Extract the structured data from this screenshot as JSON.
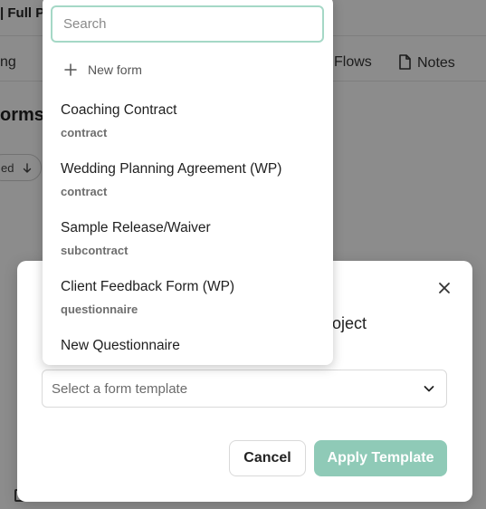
{
  "background": {
    "header_title": "| Full P",
    "tabs": [
      {
        "label": "ng"
      },
      {
        "label": "Flows"
      },
      {
        "label": "Notes"
      }
    ],
    "section_title": "orms",
    "sort_label": "ed"
  },
  "modal": {
    "subtitle": "roject",
    "select": {
      "placeholder": "Select a form template"
    },
    "cancel_label": "Cancel",
    "apply_label": "Apply Template",
    "apply_color": "#8fcab7"
  },
  "dropdown": {
    "search_placeholder": "Search",
    "new_form_label": "New form",
    "options": [
      {
        "title": "Coaching Contract",
        "type": "contract"
      },
      {
        "title": "Wedding Planning Agreement (WP)",
        "type": "contract"
      },
      {
        "title": "Sample Release/Waiver",
        "type": "subcontract"
      },
      {
        "title": "Client Feedback Form (WP)",
        "type": "questionnaire"
      },
      {
        "title": "New Questionnaire",
        "type": ""
      }
    ]
  },
  "colors": {
    "accent": "#8fcab7",
    "search_border": "#a5d8c6"
  }
}
